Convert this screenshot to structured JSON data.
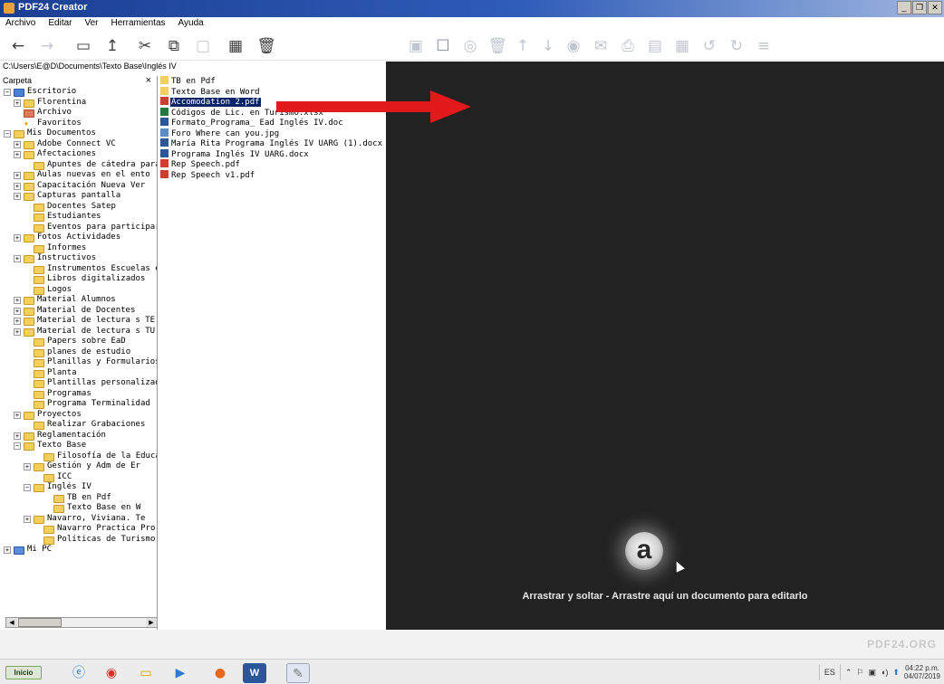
{
  "window": {
    "title": "PDF24 Creator"
  },
  "menu": [
    "Archivo",
    "Editar",
    "Ver",
    "Herramientas",
    "Ayuda"
  ],
  "path": "C:\\Users\\E@D\\Documents\\Texto Base\\Inglés IV",
  "folder_panel": {
    "header": "Carpeta",
    "close": "×",
    "tree": [
      {
        "label": "Escritorio",
        "depth": 0,
        "exp": "−",
        "icon": "blue"
      },
      {
        "label": "Florentina",
        "depth": 1,
        "exp": "+",
        "icon": "folder"
      },
      {
        "label": "Archivo",
        "depth": 1,
        "exp": "",
        "icon": "arch"
      },
      {
        "label": "Favoritos",
        "depth": 1,
        "exp": "",
        "icon": "star"
      },
      {
        "label": "Mis Documentos",
        "depth": 0,
        "exp": "−",
        "icon": "folder"
      },
      {
        "label": "Adobe Connect VC",
        "depth": 1,
        "exp": "+",
        "icon": "folder"
      },
      {
        "label": "Afectaciones",
        "depth": 1,
        "exp": "+",
        "icon": "folder"
      },
      {
        "label": "Apuntes de cátedra para",
        "depth": 2,
        "exp": "",
        "icon": "folder"
      },
      {
        "label": "Aulas nuevas en el ento",
        "depth": 1,
        "exp": "+",
        "icon": "folder"
      },
      {
        "label": "Capacitación Nueva Ver",
        "depth": 1,
        "exp": "+",
        "icon": "folder"
      },
      {
        "label": "Capturas pantalla",
        "depth": 1,
        "exp": "+",
        "icon": "folder"
      },
      {
        "label": "Docentes Satep",
        "depth": 2,
        "exp": "",
        "icon": "folder"
      },
      {
        "label": "Estudiantes",
        "depth": 2,
        "exp": "",
        "icon": "folder"
      },
      {
        "label": "Eventos para participar",
        "depth": 2,
        "exp": "",
        "icon": "folder"
      },
      {
        "label": "Fotos Actividades",
        "depth": 1,
        "exp": "+",
        "icon": "folder"
      },
      {
        "label": "Informes",
        "depth": 2,
        "exp": "",
        "icon": "folder"
      },
      {
        "label": "Instructivos",
        "depth": 1,
        "exp": "+",
        "icon": "folder"
      },
      {
        "label": "Instrumentos Escuelas e",
        "depth": 2,
        "exp": "",
        "icon": "folder"
      },
      {
        "label": "Libros digitalizados",
        "depth": 2,
        "exp": "",
        "icon": "folder"
      },
      {
        "label": "Logos",
        "depth": 2,
        "exp": "",
        "icon": "folder"
      },
      {
        "label": "Material Alumnos",
        "depth": 1,
        "exp": "+",
        "icon": "folder"
      },
      {
        "label": "Material  de Docentes",
        "depth": 1,
        "exp": "+",
        "icon": "folder"
      },
      {
        "label": "Material de lectura s TE",
        "depth": 1,
        "exp": "+",
        "icon": "folder"
      },
      {
        "label": "Material de lectura s TU",
        "depth": 1,
        "exp": "+",
        "icon": "folder"
      },
      {
        "label": "Papers sobre EaD",
        "depth": 2,
        "exp": "",
        "icon": "folder"
      },
      {
        "label": "planes de estudio",
        "depth": 2,
        "exp": "",
        "icon": "folder"
      },
      {
        "label": "Planillas y Formularios",
        "depth": 2,
        "exp": "",
        "icon": "folder"
      },
      {
        "label": "Planta",
        "depth": 2,
        "exp": "",
        "icon": "folder"
      },
      {
        "label": "Plantillas personalizadas",
        "depth": 2,
        "exp": "",
        "icon": "folder"
      },
      {
        "label": "Programas",
        "depth": 2,
        "exp": "",
        "icon": "folder"
      },
      {
        "label": "Programa Terminalidad",
        "depth": 2,
        "exp": "",
        "icon": "folder"
      },
      {
        "label": "Proyectos",
        "depth": 1,
        "exp": "+",
        "icon": "folder"
      },
      {
        "label": "Realizar Grabaciones",
        "depth": 2,
        "exp": "",
        "icon": "folder"
      },
      {
        "label": "Reglamentación",
        "depth": 1,
        "exp": "+",
        "icon": "folder"
      },
      {
        "label": "Texto Base",
        "depth": 1,
        "exp": "−",
        "icon": "folder"
      },
      {
        "label": "Filosofía de la Educa",
        "depth": 3,
        "exp": "",
        "icon": "folder"
      },
      {
        "label": "Gestión y Adm de Er",
        "depth": 2,
        "exp": "+",
        "icon": "folder"
      },
      {
        "label": "ICC",
        "depth": 3,
        "exp": "",
        "icon": "folder"
      },
      {
        "label": "Inglés IV",
        "depth": 2,
        "exp": "−",
        "icon": "folder"
      },
      {
        "label": "TB en Pdf",
        "depth": 4,
        "exp": "",
        "icon": "folder"
      },
      {
        "label": "Texto Base en W",
        "depth": 4,
        "exp": "",
        "icon": "folder"
      },
      {
        "label": "Navarro, Viviana. Te",
        "depth": 2,
        "exp": "+",
        "icon": "folder"
      },
      {
        "label": "Navarro Practica Pro",
        "depth": 3,
        "exp": "",
        "icon": "folder"
      },
      {
        "label": "Políticas de Turismo",
        "depth": 3,
        "exp": "",
        "icon": "folder"
      },
      {
        "label": "Mi PC",
        "depth": 0,
        "exp": "+",
        "icon": "pc"
      }
    ]
  },
  "files": [
    {
      "name": "TB en Pdf",
      "type": "folder",
      "selected": false
    },
    {
      "name": "Texto Base en Word",
      "type": "folder",
      "selected": false
    },
    {
      "name": "Accomodation 2.pdf",
      "type": "pdf",
      "selected": true
    },
    {
      "name": "Códigos de Lic. en Turismo.xlsx",
      "type": "xlsx",
      "selected": false
    },
    {
      "name": "Formato_Programa_ Ead Inglés IV.doc",
      "type": "doc",
      "selected": false
    },
    {
      "name": "Foro Where can you.jpg",
      "type": "jpg",
      "selected": false
    },
    {
      "name": "María Rita Programa Inglés IV UARG (1).docx",
      "type": "doc",
      "selected": false
    },
    {
      "name": "Programa Inglés IV UARG.docx",
      "type": "doc",
      "selected": false
    },
    {
      "name": "Rep Speech.pdf",
      "type": "pdf",
      "selected": false
    },
    {
      "name": "Rep Speech v1.pdf",
      "type": "pdf",
      "selected": false
    }
  ],
  "drop_area": {
    "logo_letter": "a",
    "message": "Arrastrar y soltar - Arrastre aquí un documento para editarlo"
  },
  "brand": "PDF24.ORG",
  "taskbar": {
    "start_label": "Inicio",
    "lang": "ES",
    "time": "04:22 p.m.",
    "date": "04/07/2019"
  },
  "colors": {
    "drop_bg": "#222222",
    "selection": "#0a246a",
    "arrow": "#e3191c",
    "titlebar": "#1b3f93"
  }
}
